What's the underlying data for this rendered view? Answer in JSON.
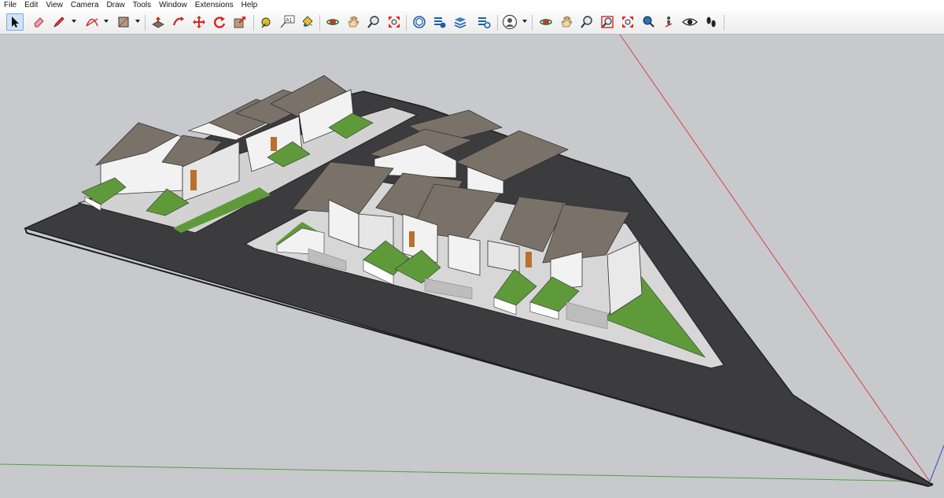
{
  "menu": [
    "File",
    "Edit",
    "View",
    "Camera",
    "Draw",
    "Tools",
    "Window",
    "Extensions",
    "Help"
  ],
  "toolbar": {
    "groups": [
      [
        "select-icon",
        "eraser-icon",
        "pencil-line-icon",
        "arc-icon",
        "rectangle-icon"
      ],
      [
        "push-pull-icon",
        "follow-me-icon",
        "move-icon",
        "rotate-icon",
        "scale-icon"
      ],
      [
        "tape-measure-icon",
        "text-icon",
        "paint-bucket-icon"
      ],
      [
        "orbit-icon",
        "pan-icon",
        "zoom-icon",
        "zoom-extents-icon"
      ],
      [
        "3d-warehouse-icon",
        "extension-warehouse-icon",
        "layout-icon",
        "extension-manager-icon"
      ],
      [
        "account-icon"
      ],
      [
        "orbit-icon",
        "pan-icon",
        "zoom-icon",
        "zoom-window-icon",
        "zoom-extents-icon",
        "previous-view-icon",
        "position-camera-icon",
        "look-around-icon",
        "walk-icon"
      ]
    ]
  },
  "colors": {
    "background": "#c8c9cc",
    "road": "#3c3c3e",
    "curb": "#d7d7d7",
    "grass": "#5f9a3a",
    "roof": "#7a7268",
    "wall": "#f2f2f2",
    "door": "#b9712b",
    "axis_red": "#d94040",
    "axis_green": "#4aa34a",
    "axis_blue": "#3a3ad0",
    "accent": "#cfe3f7"
  }
}
